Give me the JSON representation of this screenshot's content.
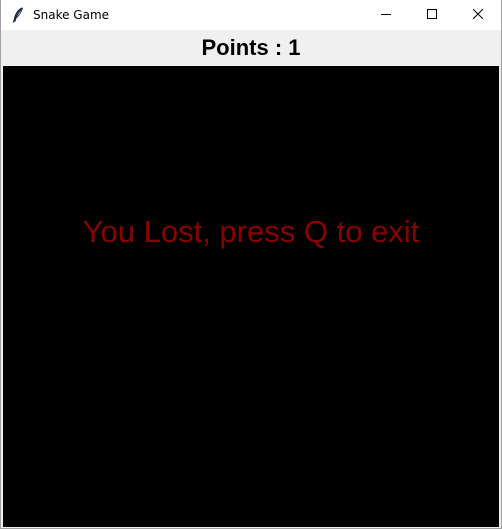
{
  "window": {
    "title": "Snake Game",
    "app_icon": "feather-icon",
    "controls": [
      "minimize-icon",
      "maximize-icon",
      "close-icon"
    ]
  },
  "score": {
    "text": "Points : 1"
  },
  "game": {
    "message": "You Lost, press Q to exit",
    "message_color": "#8b0000",
    "background_color": "#000000"
  }
}
